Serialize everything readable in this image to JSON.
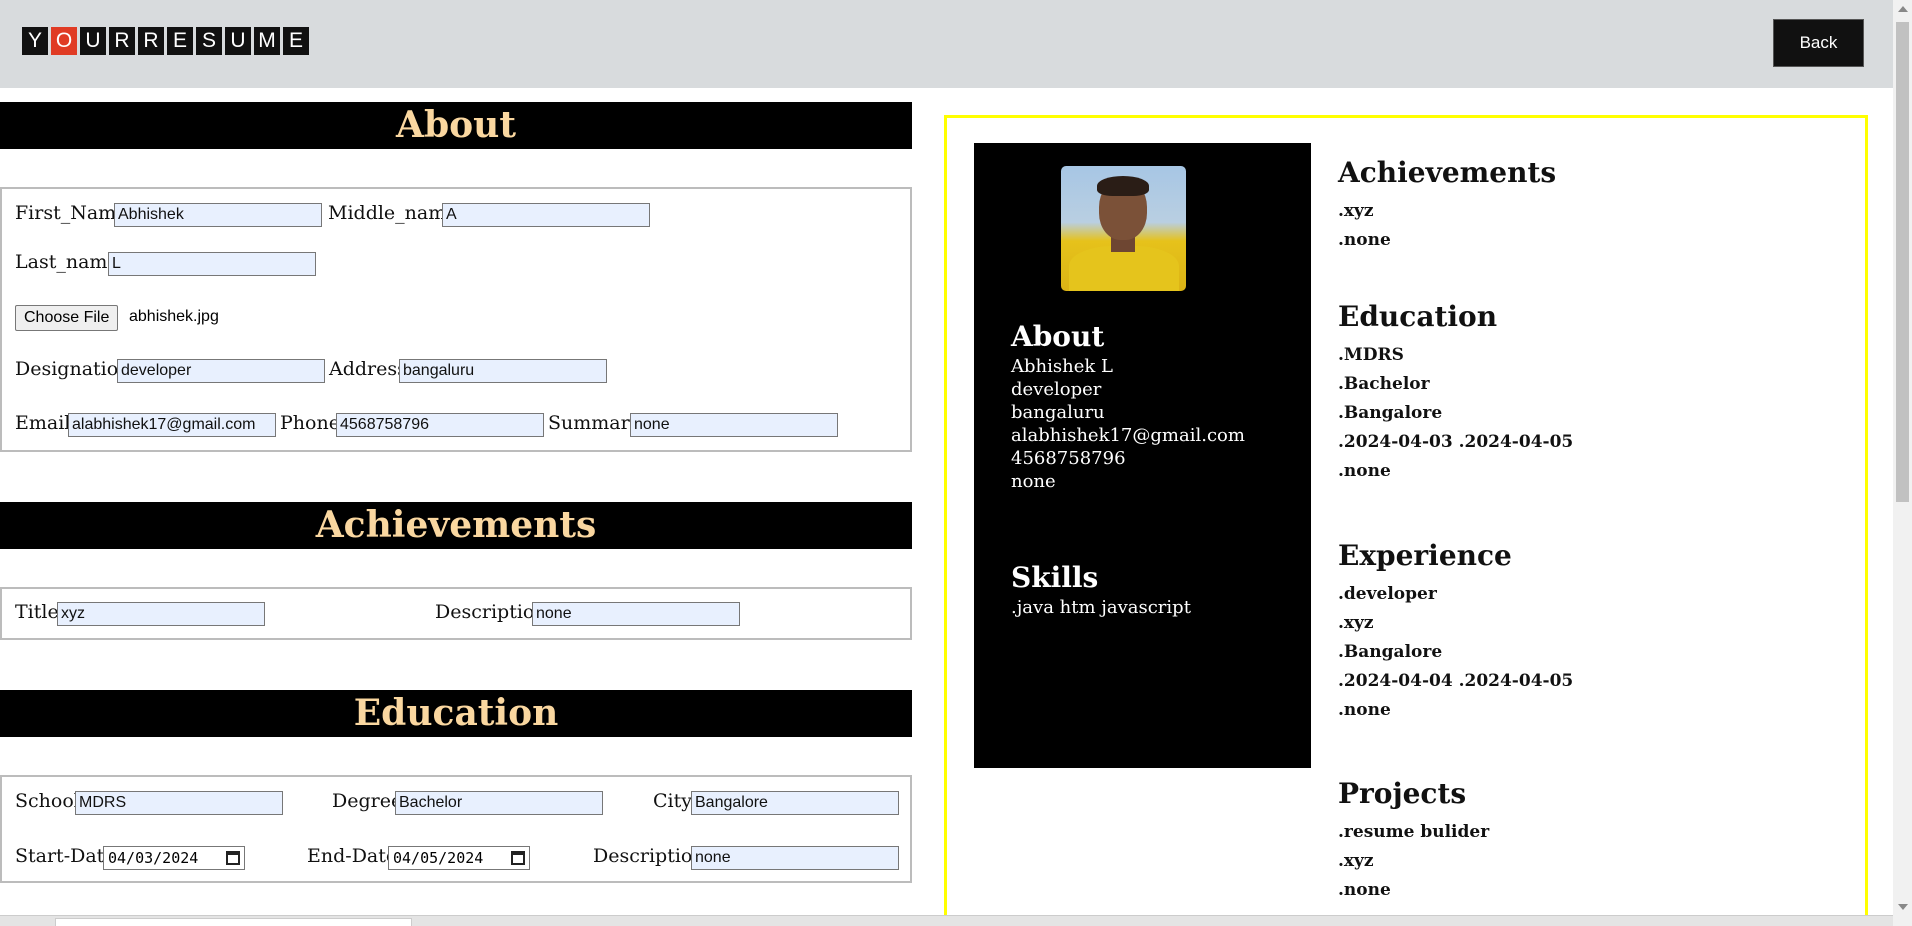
{
  "header": {
    "logo_letters": [
      "Y",
      "O",
      "U",
      "R",
      "R",
      "E",
      "S",
      "U",
      "M",
      "E"
    ],
    "back_label": "Back"
  },
  "form": {
    "about": {
      "heading": "About",
      "first_name_label": "First_Name",
      "first_name": "Abhishek",
      "middle_name_label": "Middle_name",
      "middle_name": "A",
      "last_name_label": "Last_name",
      "last_name": "L",
      "choose_file_label": "Choose File",
      "file_name": "abhishek.jpg",
      "designation_label": "Designation",
      "designation": "developer",
      "address_label": "Address",
      "address": "bangaluru",
      "email_label": "Email",
      "email": "alabhishek17@gmail.com",
      "phone_label": "Phone",
      "phone": "4568758796",
      "summary_label": "Summary",
      "summary": "none"
    },
    "achievements": {
      "heading": "Achievements",
      "title_label": "Title",
      "title": "xyz",
      "description_label": "Description",
      "description": "none"
    },
    "education": {
      "heading": "Education",
      "school_label": "School",
      "school": "MDRS",
      "degree_label": "Degree",
      "degree": "Bachelor",
      "city_label": "City",
      "city": "Bangalore",
      "start_label": "Start-Date",
      "start": "04/03/2024",
      "end_label": "End-Date",
      "end": "04/05/2024",
      "description_label": "Description",
      "description": "none"
    }
  },
  "resume": {
    "about_heading": "About",
    "about_lines": [
      "Abhishek L",
      "developer",
      "bangaluru",
      "alabhishek17@gmail.com",
      "4568758796",
      "none"
    ],
    "skills_heading": "Skills",
    "skills_text": ".java htm javascript",
    "achievements_heading": "Achievements",
    "achievements_lines": [
      ".xyz",
      ".none"
    ],
    "education_heading": "Education",
    "education_lines": [
      ".MDRS",
      ".Bachelor",
      ".Bangalore",
      ".2024-04-03 .2024-04-05",
      ".none"
    ],
    "experience_heading": "Experience",
    "experience_lines": [
      ".developer",
      ".xyz",
      ".Bangalore",
      ".2024-04-04 .2024-04-05",
      ".none"
    ],
    "projects_heading": "Projects",
    "projects_lines": [
      ".resume bulider",
      ".xyz",
      ".none"
    ]
  }
}
